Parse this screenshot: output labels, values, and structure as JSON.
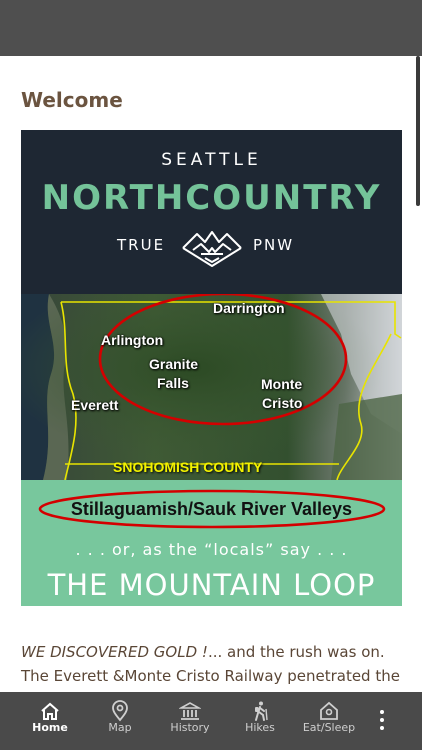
{
  "page": {
    "title": "Welcome",
    "intro_emphasis": "WE DISCOVERED GOLD !",
    "intro_rest": "... and the rush was on. The Everett &Monte Cristo Railway penetrated the"
  },
  "banner": {
    "line1": "SEATTLE",
    "line2": "NORTHCOUNTRY",
    "true_text": "TRUE",
    "pnw_text": "PNW",
    "map_labels": {
      "darrington": "Darrington",
      "arlington": "Arlington",
      "granite": "Granite",
      "falls": "Falls",
      "monte": "Monte",
      "cristo": "Cristo",
      "everett": "Everett",
      "county": "SNOHOMISH  COUNTY"
    },
    "valleys": "Stillaguamish/Sauk River Valleys",
    "locals": ". . . or, as the “locals” say . . .",
    "mountain_loop": "THE MOUNTAIN LOOP"
  },
  "nav": {
    "items": [
      {
        "label": "Home",
        "icon": "home-icon"
      },
      {
        "label": "Map",
        "icon": "map-pin-icon"
      },
      {
        "label": "History",
        "icon": "museum-icon"
      },
      {
        "label": "Hikes",
        "icon": "hiker-icon"
      },
      {
        "label": "Eat/Sleep",
        "icon": "lodging-icon"
      }
    ],
    "more_icon": "more-vertical-icon"
  },
  "colors": {
    "status_bar": "#4f4f4f",
    "title_brown": "#6b5440",
    "banner_dark": "#1e2733",
    "brand_green": "#74c399",
    "nav_bg": "#4a4a4a",
    "ellipse_red": "#d40000",
    "county_yellow": "#f2f200"
  }
}
